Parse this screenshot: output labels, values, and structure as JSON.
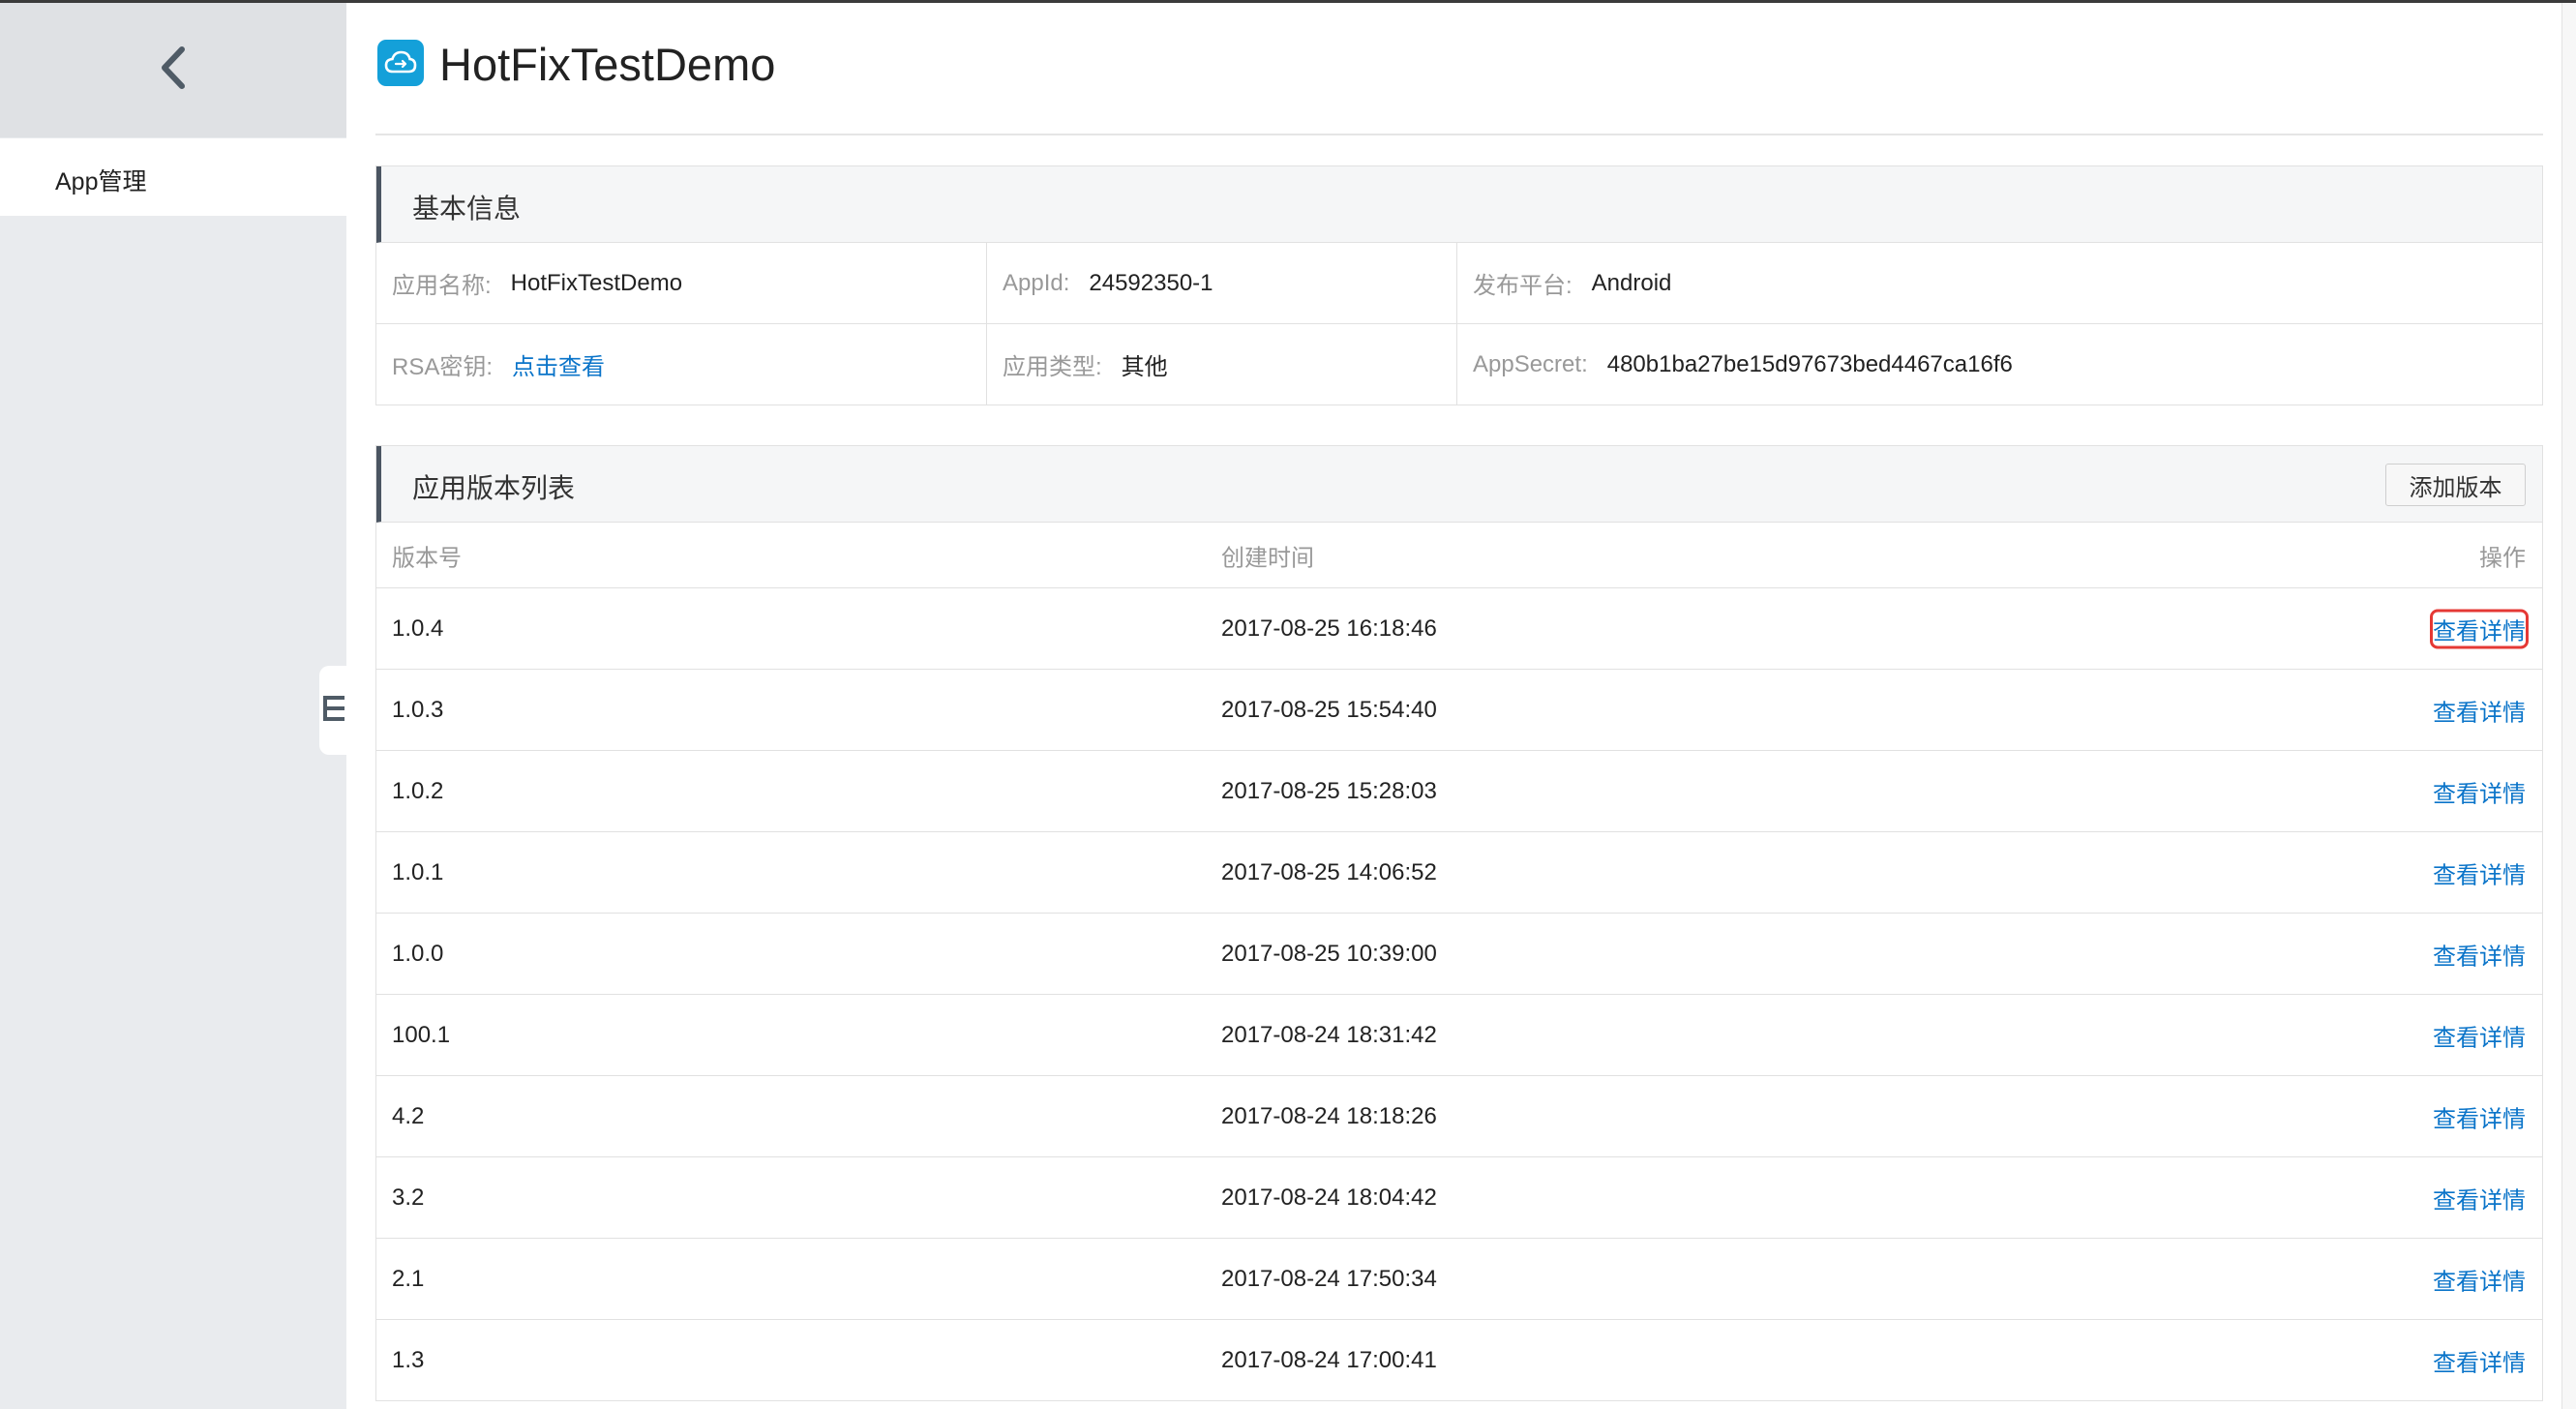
{
  "sidebar": {
    "back_icon": "chevron-left-icon",
    "items": [
      {
        "label": "App管理"
      }
    ],
    "collapse_icon": "collapse-menu-icon"
  },
  "header": {
    "logo_icon": "cloud-app-icon",
    "title": "HotFixTestDemo"
  },
  "basic_info": {
    "title": "基本信息",
    "fields": [
      {
        "label": "应用名称:",
        "value": "HotFixTestDemo",
        "link": false
      },
      {
        "label": "AppId:",
        "value": "24592350-1",
        "link": false
      },
      {
        "label": "发布平台:",
        "value": "Android",
        "link": false
      },
      {
        "label": "RSA密钥:",
        "value": "点击查看",
        "link": true
      },
      {
        "label": "应用类型:",
        "value": "其他",
        "link": false
      },
      {
        "label": "AppSecret:",
        "value": "480b1ba27be15d97673bed4467ca16f6",
        "link": false
      }
    ]
  },
  "versions": {
    "title": "应用版本列表",
    "add_button": "添加版本",
    "columns": [
      "版本号",
      "创建时间",
      "操作"
    ],
    "rows": [
      {
        "version": "1.0.4",
        "created": "2017-08-25 16:18:46",
        "action": "查看详情",
        "highlighted": true
      },
      {
        "version": "1.0.3",
        "created": "2017-08-25 15:54:40",
        "action": "查看详情",
        "highlighted": false
      },
      {
        "version": "1.0.2",
        "created": "2017-08-25 15:28:03",
        "action": "查看详情",
        "highlighted": false
      },
      {
        "version": "1.0.1",
        "created": "2017-08-25 14:06:52",
        "action": "查看详情",
        "highlighted": false
      },
      {
        "version": "1.0.0",
        "created": "2017-08-25 10:39:00",
        "action": "查看详情",
        "highlighted": false
      },
      {
        "version": "100.1",
        "created": "2017-08-24 18:31:42",
        "action": "查看详情",
        "highlighted": false
      },
      {
        "version": "4.2",
        "created": "2017-08-24 18:18:26",
        "action": "查看详情",
        "highlighted": false
      },
      {
        "version": "3.2",
        "created": "2017-08-24 18:04:42",
        "action": "查看详情",
        "highlighted": false
      },
      {
        "version": "2.1",
        "created": "2017-08-24 17:50:34",
        "action": "查看详情",
        "highlighted": false
      },
      {
        "version": "1.3",
        "created": "2017-08-24 17:00:41",
        "action": "查看详情",
        "highlighted": false
      }
    ]
  },
  "colors": {
    "link": "#0a74c9",
    "highlight_box": "#e53935",
    "logo": "#14a0d9",
    "sidebar_bg": "#e9ebee"
  }
}
